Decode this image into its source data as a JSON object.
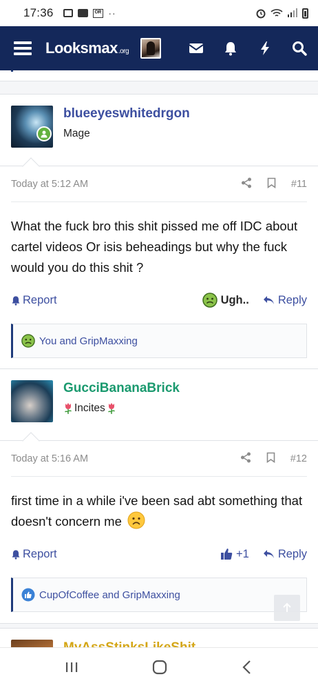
{
  "status_bar": {
    "time": "17:36"
  },
  "nav": {
    "logo_main": "Looksmax",
    "logo_suffix": ".org"
  },
  "posts": [
    {
      "username": "blueeyeswhitedrgon",
      "user_title": "Mage",
      "timestamp": "Today at 5:12 AM",
      "post_number": "#11",
      "message": "What the fuck bro this shit pissed me off IDC about cartel videos Or isis beheadings but why the fuck would you do this shit ?",
      "report_label": "Report",
      "reaction_label": "Ugh..",
      "reply_label": "Reply",
      "reactions_summary": "You and GripMaxxing"
    },
    {
      "username": "GucciBananaBrick",
      "user_title": "Incites",
      "timestamp": "Today at 5:16 AM",
      "post_number": "#12",
      "message": "first time in a while i've been sad abt something that doesn't concern me",
      "report_label": "Report",
      "reaction_label": "+1",
      "reply_label": "Reply",
      "reactions_summary": "CupOfCoffee and GripMaxxing"
    },
    {
      "username": "MyAssStinksLikeShit"
    }
  ],
  "colors": {
    "nav_bg": "#14285a",
    "link": "#3d4fa0",
    "username_green": "#1b9a6f",
    "online": "#63b13f"
  }
}
